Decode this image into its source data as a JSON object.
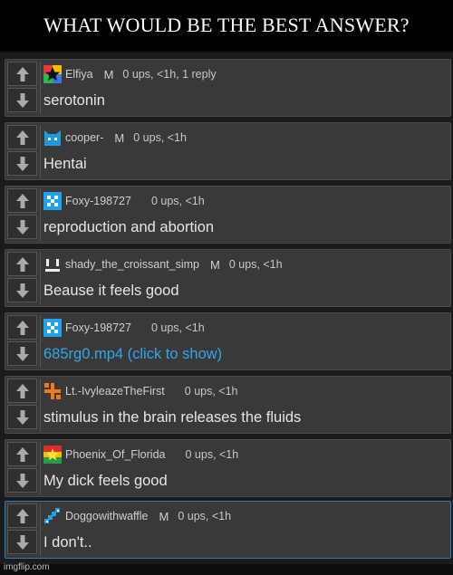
{
  "banner": "WHAT WOULD BE THE BEST ANSWER?",
  "watermark": "imgflip.com",
  "comments": [
    {
      "username": "Elfiya",
      "role": "M",
      "stats": "0 ups, <1h, 1 reply",
      "text": "serotonin",
      "avatar": "star-avatar-icon"
    },
    {
      "username": "cooper-",
      "role": "M",
      "stats": "0 ups, <1h",
      "text": "Hentai",
      "avatar": "cat-avatar-icon"
    },
    {
      "username": "Foxy-198727",
      "role": "",
      "stats": "0 ups, <1h",
      "text": "reproduction and abortion",
      "avatar": "pixel-avatar-icon"
    },
    {
      "username": "shady_the_croissant_simp",
      "role": "M",
      "stats": "0 ups, <1h",
      "text": "Beause it feels good",
      "avatar": "face-avatar-icon"
    },
    {
      "username": "Foxy-198727",
      "role": "",
      "stats": "0 ups, <1h",
      "text": "685rg0.mp4 (click to show)",
      "avatar": "pixel-avatar-icon"
    },
    {
      "username": "Lt.-IvyleazeTheFirst",
      "role": "",
      "stats": "0 ups, <1h",
      "text": "stimulus in the brain releases the fluids",
      "avatar": "cross-avatar-icon"
    },
    {
      "username": "Phoenix_Of_Florida",
      "role": "",
      "stats": "0 ups, <1h",
      "text": "My dick feels good",
      "avatar": "flag-avatar-icon"
    },
    {
      "username": "Doggowithwaffle",
      "role": "M",
      "stats": "0 ups, <1h",
      "text": "I don't..",
      "avatar": "diagonal-avatar-icon"
    }
  ]
}
